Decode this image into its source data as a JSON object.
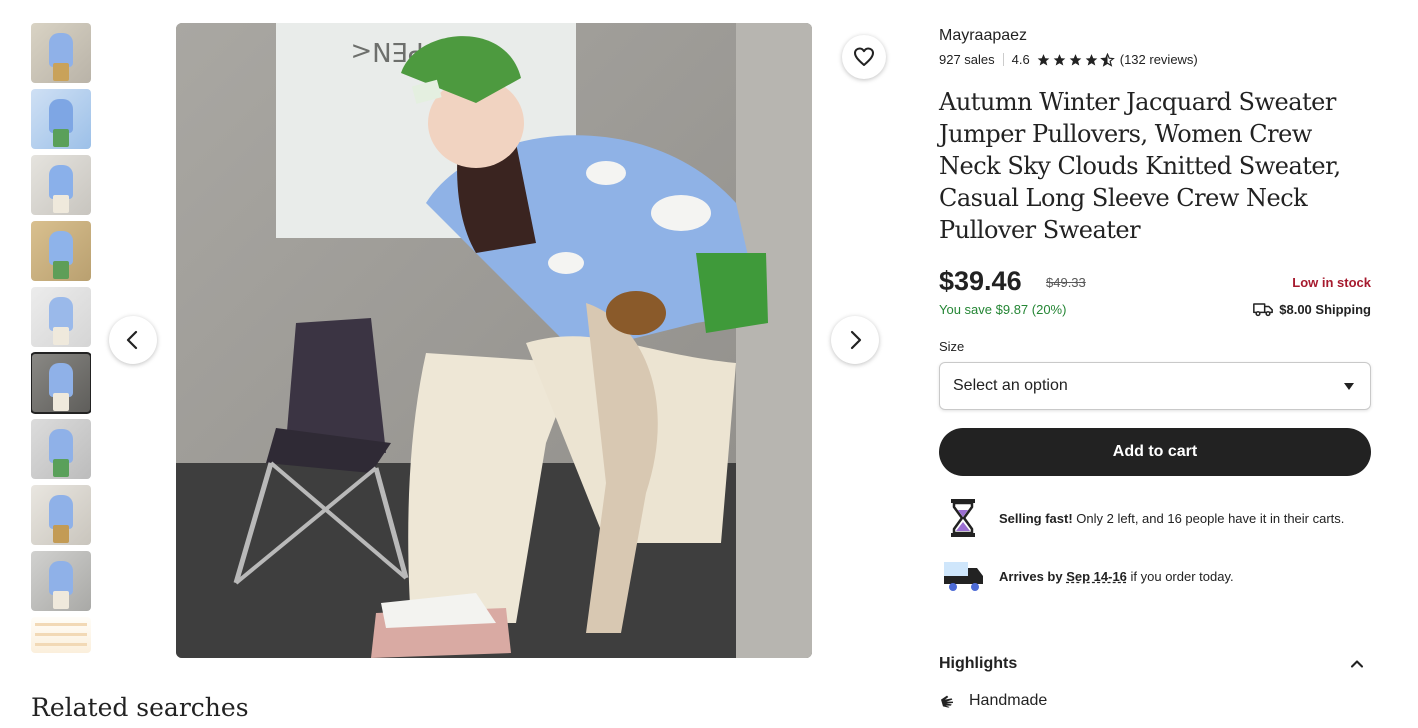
{
  "gallery": {
    "thumbnail_count": 10,
    "selected_index": 5,
    "prev_icon": "chevron-left-icon",
    "next_icon": "chevron-right-icon",
    "favorite_icon": "heart-icon"
  },
  "related_searches": {
    "title": "Related searches"
  },
  "shop": {
    "name": "Mayraapaez",
    "sales": "927 sales",
    "rating": "4.6",
    "stars": 4.5,
    "reviews": "(132 reviews)"
  },
  "product": {
    "title": "Autumn Winter Jacquard Sweater Jumper Pullovers, Women Crew Neck Sky Clouds Knitted Sweater, Casual Long Sleeve Crew Neck Pullover Sweater",
    "price": "$39.46",
    "original_price": "$49.33",
    "stock": "Low in stock",
    "savings": "You save $9.87 (20%)",
    "shipping": "$8.00 Shipping"
  },
  "size": {
    "label": "Size",
    "selected": "Select an option"
  },
  "cart": {
    "label": "Add to cart"
  },
  "notices": {
    "selling_fast_bold": "Selling fast!",
    "selling_fast_text": " Only 2 left, and 16 people have it in their carts.",
    "arrives_bold": "Arrives by ",
    "arrives_date": "Sep 14-16",
    "arrives_text": " if you order today."
  },
  "highlights": {
    "title": "Highlights",
    "items": [
      "Handmade"
    ]
  },
  "colors": {
    "accent_dark": "#222222",
    "stock_red": "#a61a2e",
    "save_green": "#258635"
  }
}
